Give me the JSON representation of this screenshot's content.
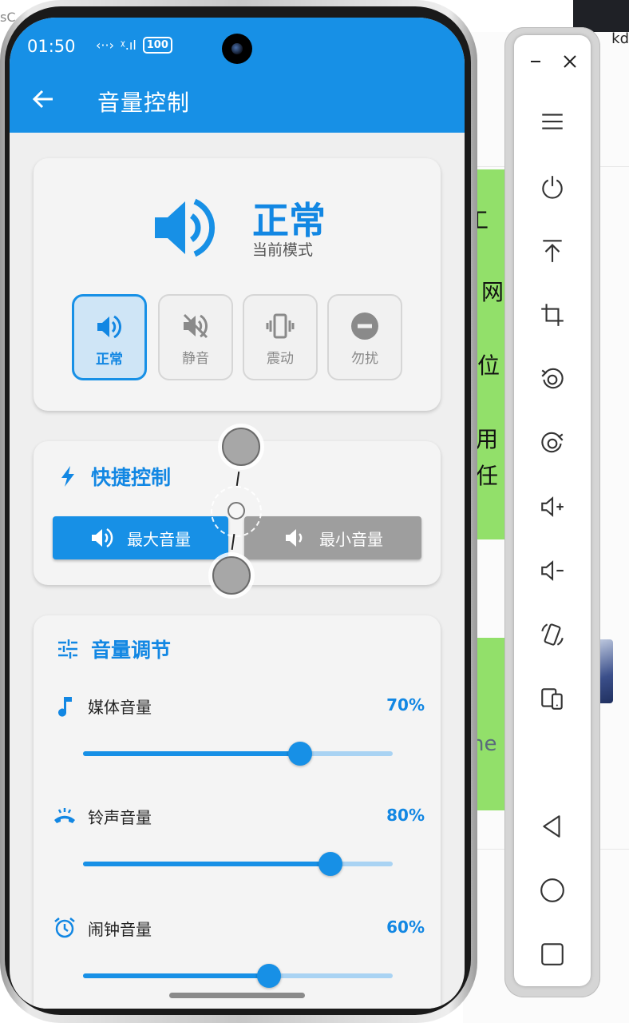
{
  "background_app": {
    "top_text": "kd",
    "left_text": "sC",
    "chars": [
      "工",
      "网",
      "位",
      "用",
      "任"
    ],
    "partial_text": "ne"
  },
  "status_bar": {
    "time": "01:50",
    "network": "‹··›",
    "signal": "ᵡ.ıl",
    "battery": "100"
  },
  "app_bar": {
    "title": "音量控制"
  },
  "mode_card": {
    "current_mode": "正常",
    "current_mode_label": "当前模式",
    "modes": [
      {
        "label": "正常",
        "active": true
      },
      {
        "label": "静音",
        "active": false
      },
      {
        "label": "震动",
        "active": false
      },
      {
        "label": "勿扰",
        "active": false
      }
    ]
  },
  "quick_card": {
    "title": "快捷控制",
    "max_button": "最大音量",
    "min_button": "最小音量"
  },
  "volume_card": {
    "title": "音量调节",
    "rows": [
      {
        "label": "媒体音量",
        "percent_text": "70%",
        "value": 0.7
      },
      {
        "label": "铃声音量",
        "percent_text": "80%",
        "value": 0.8
      },
      {
        "label": "闹钟音量",
        "percent_text": "60%",
        "value": 0.6
      }
    ]
  },
  "accent_color": "#1790e6",
  "toolbar": {
    "icons": [
      "minimize-icon",
      "close-icon",
      "menu-icon",
      "power-icon",
      "pin-top-icon",
      "crop-icon",
      "rotate-left-icon",
      "rotate-right-icon",
      "volume-up-icon",
      "volume-down-icon",
      "rotate-device-icon",
      "fold-device-icon",
      "back-icon",
      "home-icon",
      "overview-icon"
    ]
  }
}
